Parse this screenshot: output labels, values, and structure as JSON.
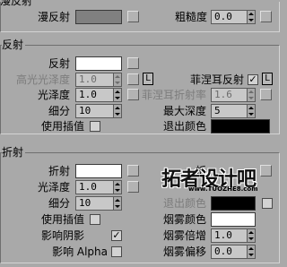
{
  "diffuse": {
    "section_title": "漫反射",
    "diffuse_label": "漫反射",
    "diffuse_color": "#808080",
    "roughness_label": "粗糙度",
    "roughness_value": "0.0"
  },
  "reflection": {
    "section_title": "反射",
    "reflect_label": "反射",
    "reflect_color": "#ffffff",
    "hilight_gloss_label": "高光光泽度",
    "hilight_gloss_value": "1.0",
    "lock_label": "L",
    "fresnel_label": "菲涅耳反射",
    "fresnel_checked": true,
    "fresnel_lock_label": "L",
    "gloss_label": "光泽度",
    "gloss_value": "1.0",
    "fresnel_ior_label": "菲涅耳折射率",
    "fresnel_ior_value": "1.6",
    "subdivs_label": "细分",
    "subdivs_value": "10",
    "max_depth_label": "最大深度",
    "max_depth_value": "5",
    "use_interp_label": "使用插值",
    "use_interp_checked": false,
    "exit_color_label": "退出颜色",
    "exit_color": "#000000"
  },
  "refraction": {
    "section_title": "折射",
    "refract_label": "折射",
    "refract_color": "#ffffff",
    "gloss_label": "光泽度",
    "gloss_value": "1.0",
    "subdivs_label": "细分",
    "subdivs_value": "10",
    "use_interp_label": "使用插值",
    "use_interp_checked": false,
    "affect_shadows_label": "影响阴影",
    "affect_shadows_checked": true,
    "affect_alpha_label": "影响 Alpha",
    "affect_alpha_checked": false,
    "ior_label": "折",
    "exit_color_label": "退出颜色",
    "exit_color": "#000000",
    "fog_color_label": "烟雾颜色",
    "fog_color": "#ffffff",
    "fog_mult_label": "烟雾倍增",
    "fog_mult_value": "1.0",
    "fog_bias_label": "烟雾偏移",
    "fog_bias_value": "0.0"
  },
  "watermark": {
    "logo_text": "拓者设计吧",
    "url_text": "www.TUOZHE8.com"
  }
}
